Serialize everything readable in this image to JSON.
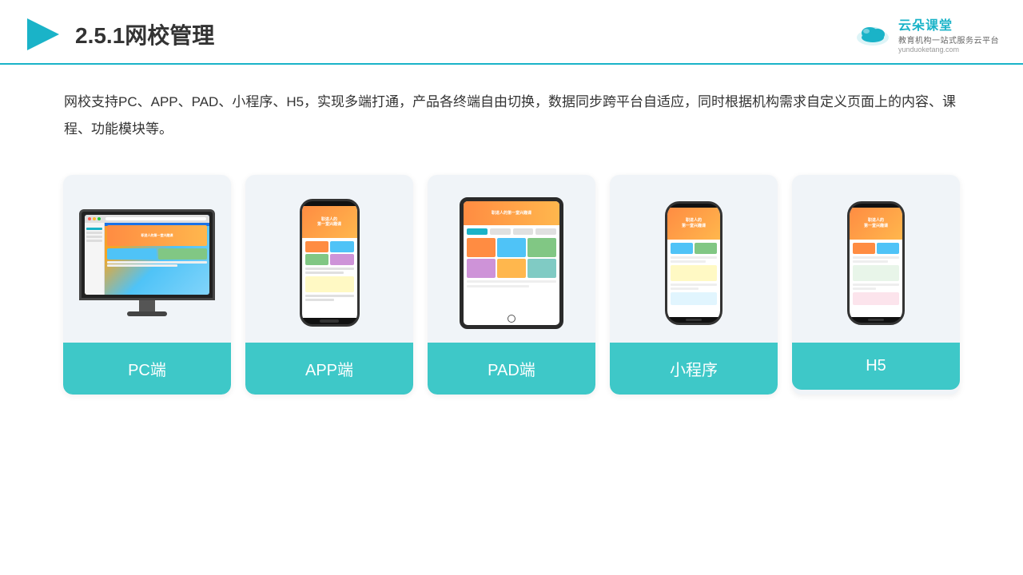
{
  "header": {
    "title": "2.5.1网校管理",
    "logo_name": "云朵课堂",
    "logo_url": "yunduoketang.com",
    "logo_sub": "教育机构一站式服务云平台"
  },
  "description": "网校支持PC、APP、PAD、小程序、H5，实现多端打通，产品各终端自由切换，数据同步跨平台自适应，同时根据机构需求自定义页面上的内容、课程、功能模块等。",
  "cards": [
    {
      "id": "pc",
      "label": "PC端"
    },
    {
      "id": "app",
      "label": "APP端"
    },
    {
      "id": "pad",
      "label": "PAD端"
    },
    {
      "id": "miniprogram",
      "label": "小程序"
    },
    {
      "id": "h5",
      "label": "H5"
    }
  ],
  "colors": {
    "accent": "#3ec8c8",
    "header_border": "#1ab3c8",
    "card_bg": "#f0f4f8",
    "orange": "#ff8c42"
  }
}
